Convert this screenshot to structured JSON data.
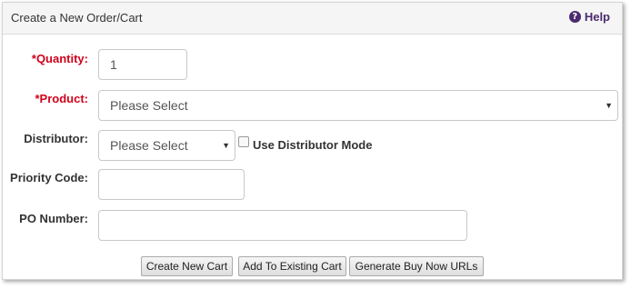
{
  "header": {
    "title": "Create a New Order/Cart",
    "help_label": "Help",
    "help_icon": "?"
  },
  "form": {
    "quantity": {
      "label": "Quantity:",
      "required_mark": "*",
      "value": "1"
    },
    "product": {
      "label": "Product:",
      "required_mark": "*",
      "selected": "Please Select"
    },
    "distributor": {
      "label": "Distributor:",
      "selected": "Please Select",
      "mode_label": "Use Distributor Mode"
    },
    "priority_code": {
      "label": "Priority Code:",
      "value": ""
    },
    "po_number": {
      "label": "PO Number:",
      "value": ""
    }
  },
  "buttons": {
    "create": "Create New Cart",
    "add_existing": "Add To Existing Cart",
    "generate": "Generate Buy Now URLs"
  }
}
